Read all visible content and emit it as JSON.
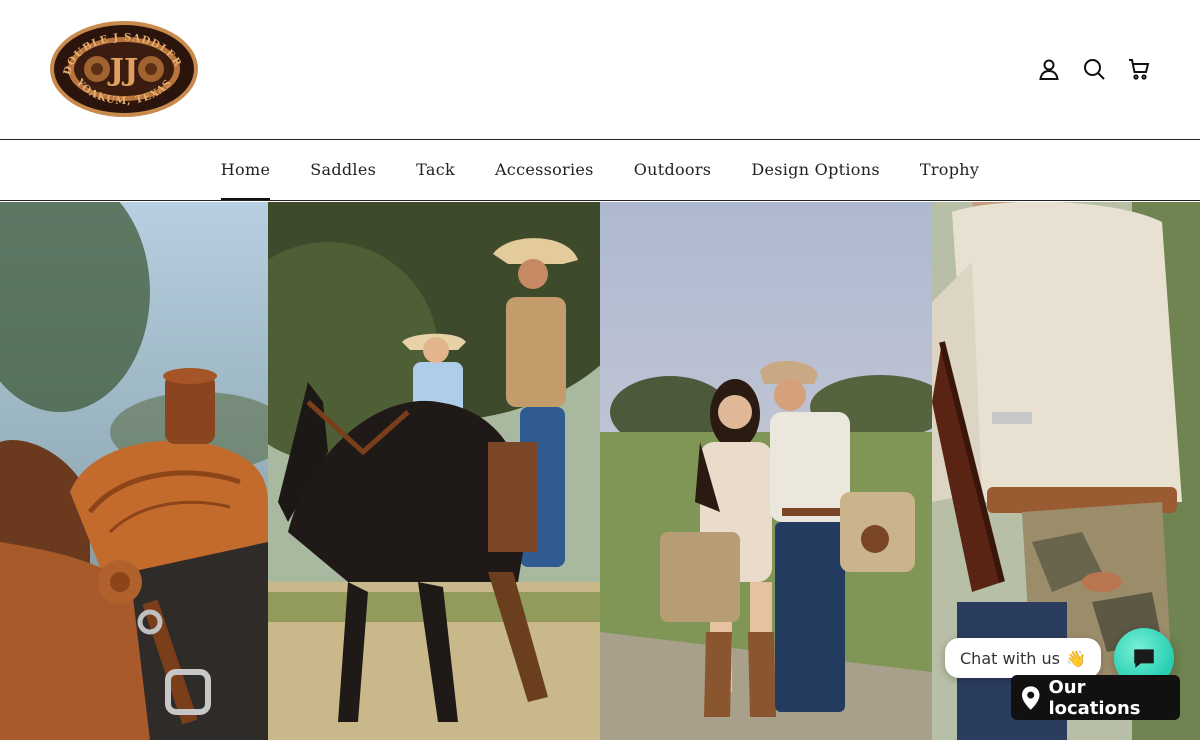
{
  "brand": {
    "logo_top": "DOUBLE J SADDLERY",
    "logo_bottom": "YOAKUM, TEXAS",
    "logo_mark": "JJ"
  },
  "header_icons": [
    "account-icon",
    "search-icon",
    "cart-icon"
  ],
  "nav": {
    "items": [
      {
        "label": "Home",
        "active": true
      },
      {
        "label": "Saddles",
        "active": false
      },
      {
        "label": "Tack",
        "active": false
      },
      {
        "label": "Accessories",
        "active": false
      },
      {
        "label": "Outdoors",
        "active": false
      },
      {
        "label": "Design Options",
        "active": false
      },
      {
        "label": "Trophy",
        "active": false
      }
    ]
  },
  "hero": {
    "panels": [
      "saddle-closeup-photo",
      "riders-on-horses-photo",
      "couple-with-bags-photo",
      "man-with-gun-case-photo"
    ]
  },
  "chat": {
    "bubble_text": "Chat with us",
    "wave": "👋"
  },
  "locations": {
    "label": "Our locations"
  },
  "colors": {
    "logo_dark": "#2a140c",
    "logo_tan": "#c98a4e",
    "chat_teal": "#2fd3b7",
    "locations_bg": "#111111"
  }
}
